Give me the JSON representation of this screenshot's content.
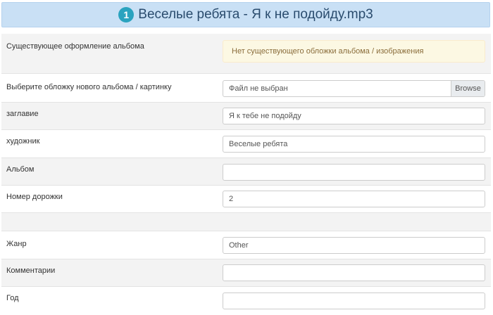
{
  "header": {
    "badge": "1",
    "title": "Веселые ребята - Я к не подойду.mp3"
  },
  "rows": {
    "cover": {
      "label": "Существующее оформление альбома",
      "alert": "Нет существующего обложки альбома / изображения"
    },
    "new_cover": {
      "label": "Выберите обложку нового альбома / картинку",
      "file_text": "Файл не выбран",
      "browse": "Browse"
    },
    "title": {
      "label": "заглавие",
      "value": "Я к тебе не подойду"
    },
    "artist": {
      "label": "художник",
      "value": "Веселые ребята"
    },
    "album": {
      "label": "Альбом",
      "value": ""
    },
    "track": {
      "label": "Номер дорожки",
      "value": "2"
    },
    "genre": {
      "label": "Жанр",
      "value": "Other"
    },
    "comment": {
      "label": "Комментарии",
      "value": ""
    },
    "year": {
      "label": "Год",
      "value": ""
    }
  }
}
